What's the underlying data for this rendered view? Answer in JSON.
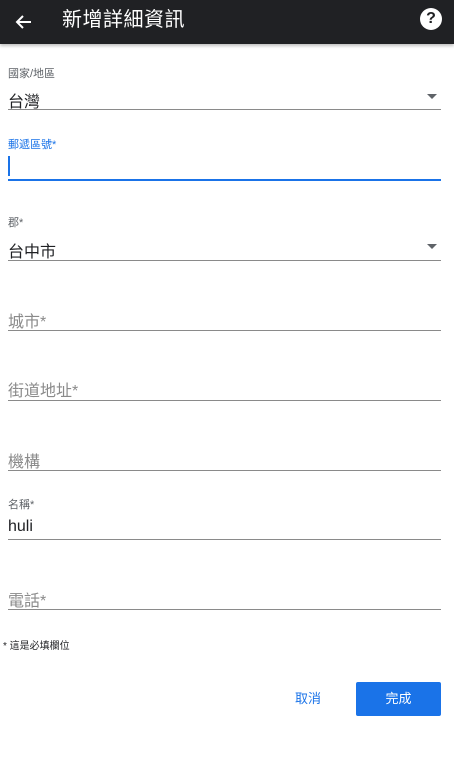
{
  "header": {
    "title": "新增詳細資訊",
    "back_icon": "arrow-left-icon",
    "help_icon": "help-circle-icon",
    "help_glyph": "?"
  },
  "form": {
    "country": {
      "label": "國家/地區",
      "value": "台灣"
    },
    "postal_code": {
      "label": "郵遞區號*",
      "value": ""
    },
    "county": {
      "label": "郡*",
      "value": "台中市"
    },
    "city": {
      "placeholder": "城市*"
    },
    "street": {
      "placeholder": "街道地址*"
    },
    "organization": {
      "placeholder": "機構"
    },
    "name": {
      "label": "名稱*",
      "value": "huli"
    },
    "phone": {
      "placeholder": "電話*"
    }
  },
  "required_note": "* 這是必填欄位",
  "actions": {
    "cancel_label": "取消",
    "done_label": "完成"
  },
  "colors": {
    "accent": "#1a73e8",
    "topbar": "#202124"
  }
}
